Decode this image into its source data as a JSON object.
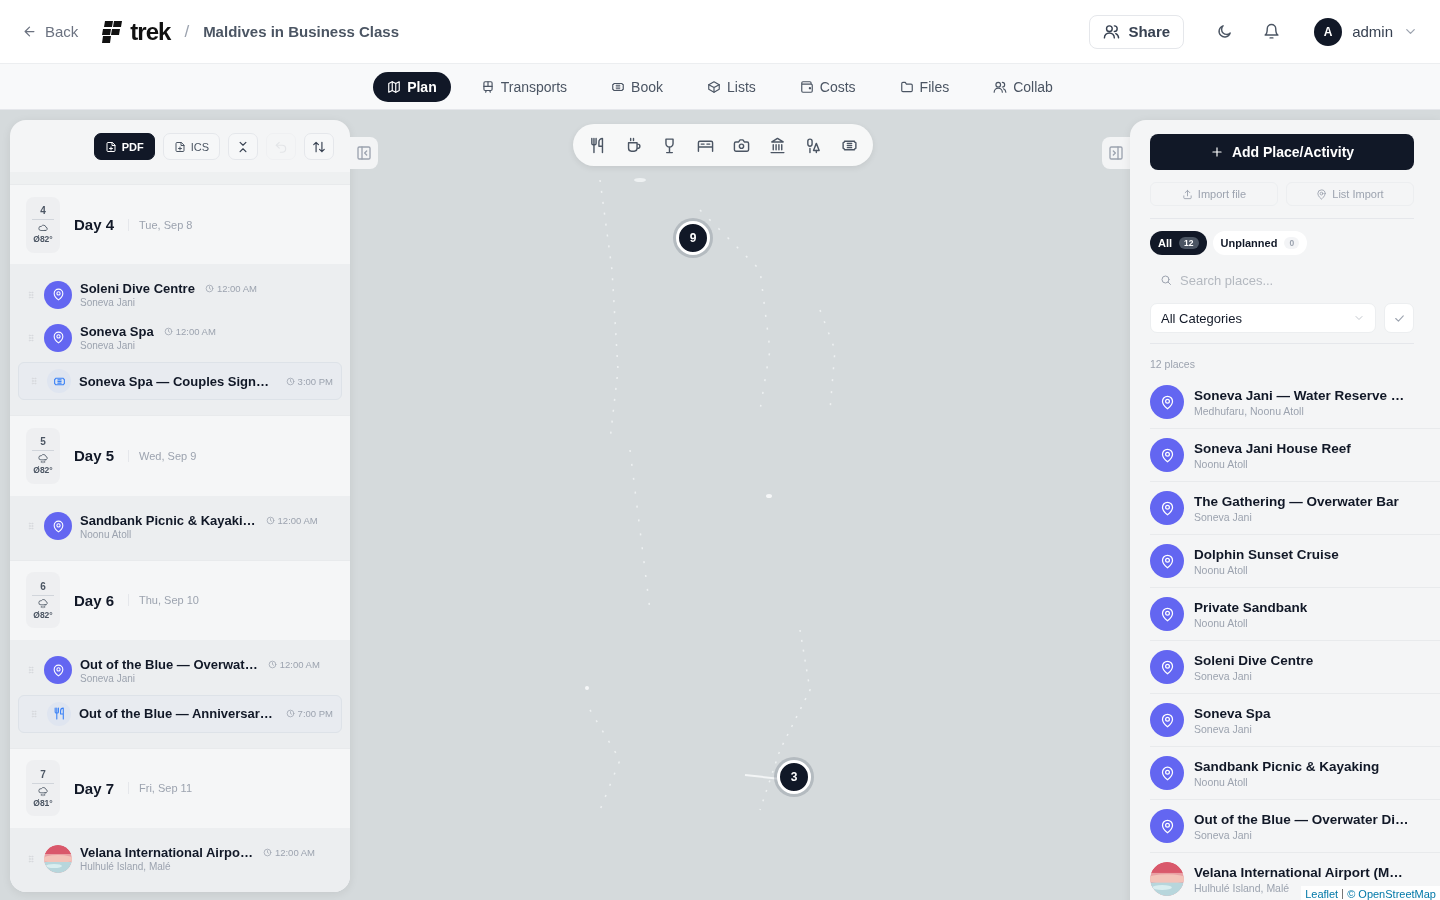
{
  "header": {
    "back": "Back",
    "logo": "trek",
    "separator": "/",
    "trip_title": "Maldives in Business Class",
    "share": "Share",
    "user": {
      "initial": "A",
      "name": "admin"
    }
  },
  "tabs": [
    {
      "label": "Plan",
      "selected": true
    },
    {
      "label": "Transports",
      "selected": false
    },
    {
      "label": "Book",
      "selected": false
    },
    {
      "label": "Lists",
      "selected": false
    },
    {
      "label": "Costs",
      "selected": false
    },
    {
      "label": "Files",
      "selected": false
    },
    {
      "label": "Collab",
      "selected": false
    }
  ],
  "left_panel": {
    "export_buttons": [
      "PDF",
      "ICS"
    ],
    "icon_buttons": [
      {
        "disabled": false
      },
      {
        "disabled": true
      },
      {
        "disabled": false
      }
    ],
    "days": [
      {
        "number": "4",
        "temperature": "Ø82°",
        "title": "Day 4",
        "date": "Tue, Sep 8",
        "items": [
          {
            "kind": "place",
            "name": "Soleni Dive Centre",
            "time": "12:00 AM",
            "location": "Soneva Jani"
          },
          {
            "kind": "place",
            "name": "Soneva Spa",
            "time": "12:00 AM",
            "location": "Soneva Jani"
          },
          {
            "kind": "ticket",
            "name": "Soneva Spa — Couples Sign…",
            "time": "3:00 PM"
          }
        ]
      },
      {
        "number": "5",
        "temperature": "Ø82°",
        "title": "Day 5",
        "date": "Wed, Sep 9",
        "items": [
          {
            "kind": "place",
            "name": "Sandbank Picnic & Kayaki…",
            "time": "12:00 AM",
            "location": "Noonu Atoll"
          }
        ]
      },
      {
        "number": "6",
        "temperature": "Ø82°",
        "title": "Day 6",
        "date": "Thu, Sep 10",
        "items": [
          {
            "kind": "place",
            "name": "Out of the Blue — Overwat…",
            "time": "12:00 AM",
            "location": "Soneva Jani"
          },
          {
            "kind": "dining",
            "name": "Out of the Blue — Anniversar…",
            "time": "7:00 PM"
          }
        ]
      },
      {
        "number": "7",
        "temperature": "Ø81°",
        "title": "Day 7",
        "date": "Fri, Sep 11",
        "items": [
          {
            "name": "Velana International Airpo…",
            "time": "12:00 AM",
            "location": "Hulhulé Island, Malé"
          }
        ]
      }
    ]
  },
  "map": {
    "clusters": [
      "9",
      "3"
    ],
    "attribution": [
      "Leaflet",
      "© OpenStreetMap"
    ]
  },
  "right_panel": {
    "add_button": "Add Place/Activity",
    "import_buttons": [
      "Import file",
      "List Import"
    ],
    "filters": [
      {
        "label": "All",
        "count": "12",
        "selected": true
      },
      {
        "label": "Unplanned",
        "count": "0",
        "selected": false
      }
    ],
    "search": {
      "placeholder": "Search places..."
    },
    "category_select": "All Categories",
    "count": "12 places",
    "places": [
      {
        "kind": "place",
        "name": "Soneva Jani — Water Reserve …",
        "location": "Medhufaru, Noonu Atoll"
      },
      {
        "kind": "place",
        "name": "Soneva Jani House Reef",
        "location": "Noonu Atoll"
      },
      {
        "kind": "place",
        "name": "The Gathering — Overwater Bar",
        "location": "Soneva Jani"
      },
      {
        "kind": "place",
        "name": "Dolphin Sunset Cruise",
        "location": "Noonu Atoll"
      },
      {
        "kind": "place",
        "name": "Private Sandbank",
        "location": "Noonu Atoll"
      },
      {
        "kind": "place",
        "name": "Soleni Dive Centre",
        "location": "Soneva Jani"
      },
      {
        "kind": "place",
        "name": "Soneva Spa",
        "location": "Soneva Jani"
      },
      {
        "kind": "place",
        "name": "Sandbank Picnic & Kayaking",
        "location": "Noonu Atoll"
      },
      {
        "kind": "place",
        "name": "Out of the Blue — Overwater Di…",
        "location": "Soneva Jani"
      },
      {
        "name": "Velana International Airport (M…",
        "location": "Hulhulé Island, Malé"
      }
    ]
  }
}
